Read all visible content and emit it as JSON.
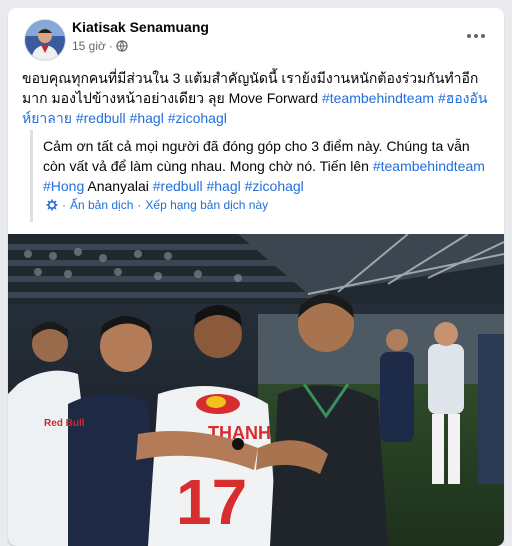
{
  "post": {
    "author": "Kiatisak Senamuang",
    "time": "15 giờ",
    "dot": "·",
    "text_main": "ขอบคุณทุกคนที่มีส่วนใน 3 แต้มสำคัญนัดนี้ เราย้งมีงานหนักต้องร่วมกันทำอีกมาก มองไปข้างหน้าอย่างเดียว ลุย Move Forward",
    "hashtags": [
      "#teambehindteam",
      "#ฮองอันห์ยาลาย",
      "#redbull",
      "#hagl",
      "#zicohagl"
    ]
  },
  "translation": {
    "text_main": "Cảm ơn tất cả mọi người đã đóng góp cho 3 điểm này. Chúng ta vẫn còn vất vả để làm cùng nhau. Mong chờ nó. Tiến lên",
    "tag1": "#teambehindteam",
    "hong": "#Hong",
    "name_rest": " Ananyalai",
    "tag2": "#redbull",
    "tag3": "#hagl",
    "tag4": "#zicohagl",
    "hide": "Ẩn bản dịch",
    "rate": "Xếp hạng bản dịch này",
    "sep": "·"
  },
  "photo": {
    "jersey_name": "THANH",
    "jersey_number": "17",
    "shirt_sponsor": "Red Bull"
  },
  "colors": {
    "link": "#216fdb",
    "text": "#050505",
    "meta": "#65676b"
  },
  "icons": [
    "globe-icon",
    "gear-icon",
    "more-options-icon"
  ]
}
